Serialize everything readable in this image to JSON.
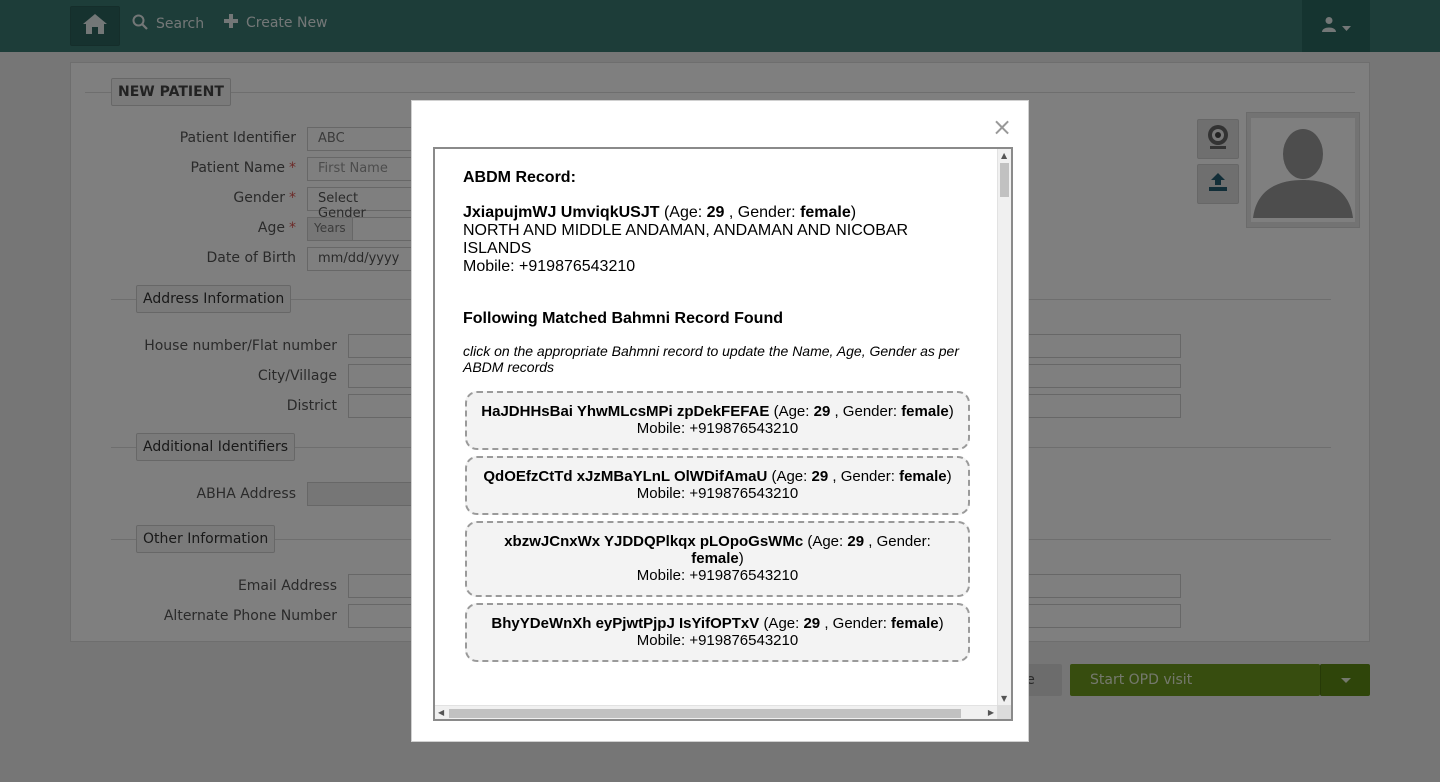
{
  "nav": {
    "search_label": "Search",
    "create_label": "Create New"
  },
  "form": {
    "section_title": "NEW PATIENT",
    "labels": {
      "patient_identifier": "Patient Identifier",
      "patient_name": "Patient Name",
      "gender": "Gender",
      "age": "Age",
      "dob": "Date of Birth",
      "house": "House number/Flat number",
      "city": "City/Village",
      "district": "District",
      "abha": "ABHA Address",
      "email": "Email Address",
      "alt_phone": "Alternate Phone Number"
    },
    "required_mark": "*",
    "values": {
      "identifier_prefix": "ABC",
      "first_name_placeholder": "First Name",
      "gender_select": "Select Gender",
      "age_years": "Years",
      "dob_placeholder": "mm/dd/yyyy"
    },
    "sections": {
      "address": "Address Information",
      "additional_ids": "Additional Identifiers",
      "other": "Other Information"
    },
    "buttons": {
      "save_partial": "ve",
      "start_opd": "Start OPD visit"
    }
  },
  "modal": {
    "close_glyph": "×",
    "abdm_title": "ABDM Record:",
    "abdm_record": {
      "name": "JxiapujmWJ UmviqkUSJT",
      "age_label": "(Age:",
      "age": "29",
      "gender_label": ", Gender:",
      "gender": "female",
      "close_paren": ")",
      "address_line1": "NORTH AND MIDDLE ANDAMAN, ANDAMAN AND NICOBAR",
      "address_line2": "ISLANDS",
      "mobile": "Mobile: +919876543210"
    },
    "matched_title": "Following Matched Bahmni Record Found",
    "instruction": "click on the appropriate Bahmni record to update the Name, Age, Gender as per ABDM records",
    "records": [
      {
        "name": "HaJDHHsBai YhwMLcsMPi zpDekFEFAE",
        "age": "29",
        "gender": "female",
        "mobile": "Mobile: +919876543210"
      },
      {
        "name": "QdOEfzCtTd xJzMBaYLnL OlWDifAmaU",
        "age": "29",
        "gender": "female",
        "mobile": "Mobile: +919876543210"
      },
      {
        "name": "xbzwJCnxWx YJDDQPlkqx pLOpoGsWMc",
        "age": "29",
        "gender": "female",
        "mobile": "Mobile: +919876543210"
      },
      {
        "name": "BhyYDeWnXh eyPjwtPjpJ IsYifOPTxV",
        "age": "29",
        "gender": "female",
        "mobile": "Mobile: +919876543210"
      }
    ],
    "record_age_label": "(Age:",
    "record_gender_label": ", Gender:"
  },
  "colors": {
    "topbar": "#3b7a72",
    "start_opd": "#6e9a1e",
    "required": "#d9534f"
  }
}
